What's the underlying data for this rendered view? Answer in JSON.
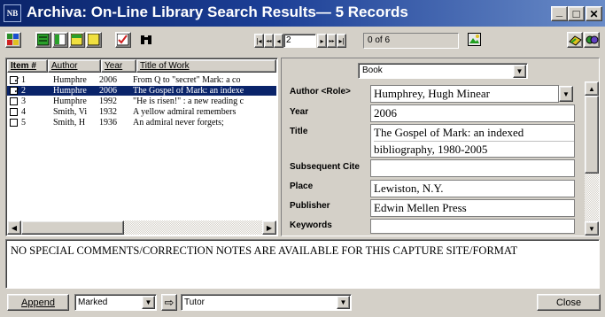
{
  "window": {
    "title": "Archiva: On-Line Library Search Results— 5 Records",
    "app_icon_text": "NB",
    "minimize_glyph": "_",
    "maximize_glyph": "□",
    "close_glyph": "✕",
    "titlebar_color": "#0a246a"
  },
  "toolbar": {
    "icons": [
      "grid-view-icon",
      "layout-single-icon",
      "layout-split-icon",
      "layout-yellow-icon",
      "layout-blank-icon",
      "checkmark-icon",
      "binoculars-icon",
      "picture-icon",
      "export-icon",
      "settings-icon"
    ],
    "nav": {
      "first": "|◂",
      "prev_page": "◂◂",
      "prev": "◂",
      "record_value": "2",
      "next": "▸",
      "next_page": "▸▸",
      "last": "▸|"
    },
    "record_status": "0 of 6"
  },
  "list": {
    "columns": [
      "Item #",
      "Author",
      "Year",
      "Title of Work"
    ],
    "selected_color": "#0a246a",
    "rows": [
      {
        "num": "1",
        "checked": true,
        "author": "Humphre",
        "year": "2006",
        "title": "From Q to \"secret\" Mark: a co"
      },
      {
        "num": "2",
        "checked": true,
        "author": "Humphre",
        "year": "2006",
        "title": "The Gospel of Mark: an indexe",
        "selected": true
      },
      {
        "num": "3",
        "checked": false,
        "author": "Humphre",
        "year": "1992",
        "title": "\"He is risen!\" : a new reading c"
      },
      {
        "num": "4",
        "checked": false,
        "author": "Smith, Vi",
        "year": "1932",
        "title": "A yellow admiral remembers"
      },
      {
        "num": "5",
        "checked": false,
        "author": "Smith, H",
        "year": "1936",
        "title": "An admiral never forgets;"
      }
    ],
    "check_glyph": "✓"
  },
  "detail": {
    "type_value": "Book",
    "fields": {
      "author": {
        "label": "Author <Role>",
        "value": "Humphrey, Hugh Minear"
      },
      "year": {
        "label": "Year",
        "value": "2006"
      },
      "title": {
        "label": "Title",
        "line1": "The Gospel of Mark: an indexed",
        "line2": "bibliography, 1980-2005"
      },
      "subsequent": {
        "label": "Subsequent Cite",
        "value": ""
      },
      "place": {
        "label": "Place",
        "value": "Lewiston, N.Y."
      },
      "publisher": {
        "label": "Publisher",
        "value": "Edwin Mellen Press"
      },
      "keywords": {
        "label": "Keywords",
        "value": ""
      }
    }
  },
  "comments": {
    "text": "NO SPECIAL COMMENTS/CORRECTION NOTES ARE AVAILABLE FOR THIS CAPTURE SITE/FORMAT"
  },
  "bottom": {
    "append_label": "Append",
    "marked_value": "Marked",
    "arrow_glyph": "⇨",
    "target_value": "Tutor",
    "close_label": "Close"
  }
}
